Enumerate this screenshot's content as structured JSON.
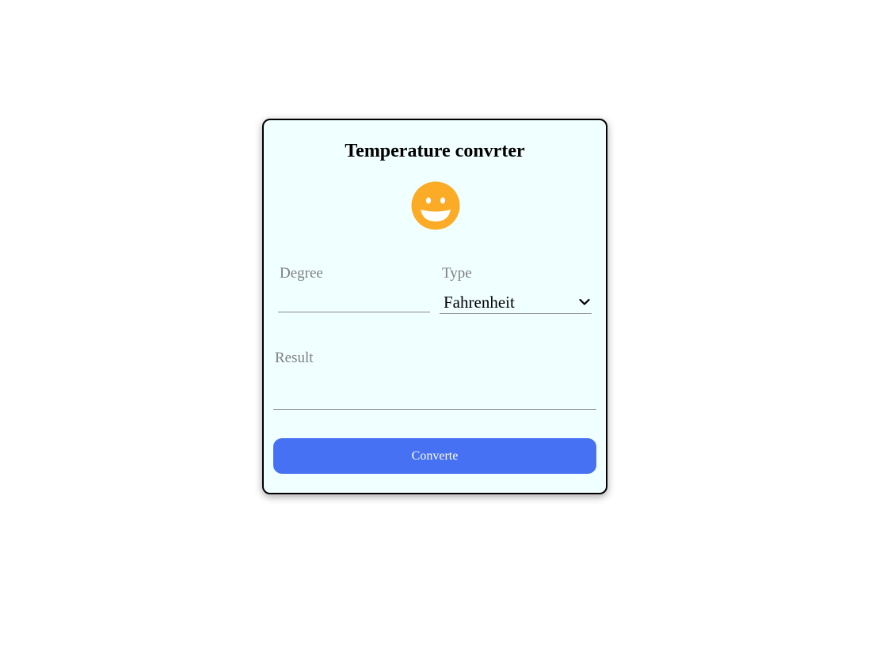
{
  "app": {
    "title": "Temperature convrter",
    "emoji_icon": "grinning-face-icon"
  },
  "form": {
    "degree_label": "Degree",
    "degree_value": "",
    "type_label": "Type",
    "type_selected": "Fahrenheit",
    "result_label": "Result",
    "result_value": "",
    "submit_label": "Converte"
  },
  "colors": {
    "card_background": "#f0ffff",
    "button": "#4671f2",
    "emoji": "#fbab25",
    "label": "#7f7f7f"
  }
}
